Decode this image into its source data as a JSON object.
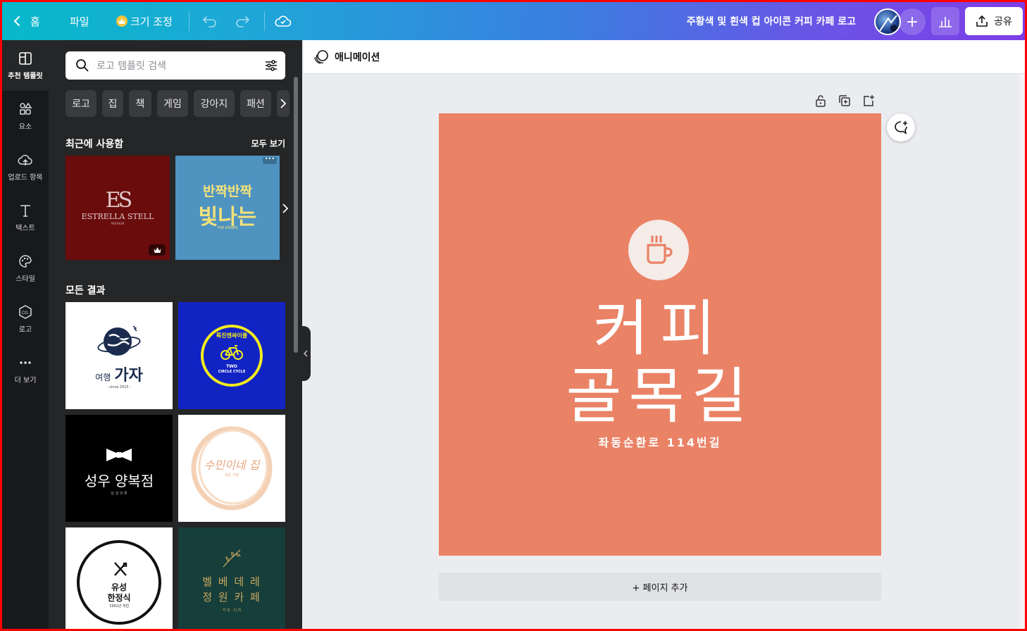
{
  "topbar": {
    "home_label": "홈",
    "file_label": "파일",
    "resize_label": "크기 조정",
    "design_title": "주황색 및 흰색 컵 아이콘 커피 카페 로고",
    "share_label": "공유"
  },
  "rail": {
    "items": [
      {
        "label": "추천 템플릿",
        "icon": "template-icon"
      },
      {
        "label": "요소",
        "icon": "elements-icon"
      },
      {
        "label": "업로드 항목",
        "icon": "upload-cloud-icon"
      },
      {
        "label": "텍스트",
        "icon": "text-icon"
      },
      {
        "label": "스타일",
        "icon": "palette-icon"
      },
      {
        "label": "로고",
        "icon": "logo-icon"
      },
      {
        "label": "더 보기",
        "icon": "more-icon"
      }
    ]
  },
  "panel": {
    "search_placeholder": "로고 템플릿 검색",
    "chips": [
      "로고",
      "집",
      "책",
      "게임",
      "강아지",
      "패션"
    ],
    "recent_title": "최근에 사용함",
    "see_all": "모두 보기",
    "all_results_title": "모든 결과",
    "recent": [
      {
        "monogram": "ES",
        "name": "ESTRELLA STELL",
        "sub": "PREMIUM",
        "bg": "#6b0c0c"
      },
      {
        "line1": "반짝반짝",
        "line2": "빛나는",
        "sub": "THE BEAMS",
        "bg": "#4f93c1"
      }
    ],
    "results": [
      {
        "text1": "여행",
        "text2": "가자",
        "sub": "- since 2015 -",
        "bg": "#ffffff"
      },
      {
        "ring": "특진엔싸이클",
        "text1": "TWO",
        "text2": "CIRCLE CYCLE",
        "bg": "#1223c4"
      },
      {
        "text1": "성우 양복점",
        "sub": "남 성 의 류",
        "bg": "#000000"
      },
      {
        "text1": "수민이네 집",
        "sub": "모든 가정",
        "bg": "#ffffff"
      },
      {
        "text1": "유성",
        "text2": "한정식",
        "sub": "1992년 개업",
        "bg": "#ffffff"
      },
      {
        "text1": "벨 베 데 레",
        "text2": "정 원 카 페",
        "sub": "커 피 · 디 저",
        "bg": "#163e3a"
      }
    ]
  },
  "canvas": {
    "animation_label": "애니메이션",
    "headline1": "커피",
    "headline2": "골목길",
    "address": "좌동순환로 114번길",
    "add_page": "+ 페이지 추가",
    "page_bg": "#ea8266"
  }
}
